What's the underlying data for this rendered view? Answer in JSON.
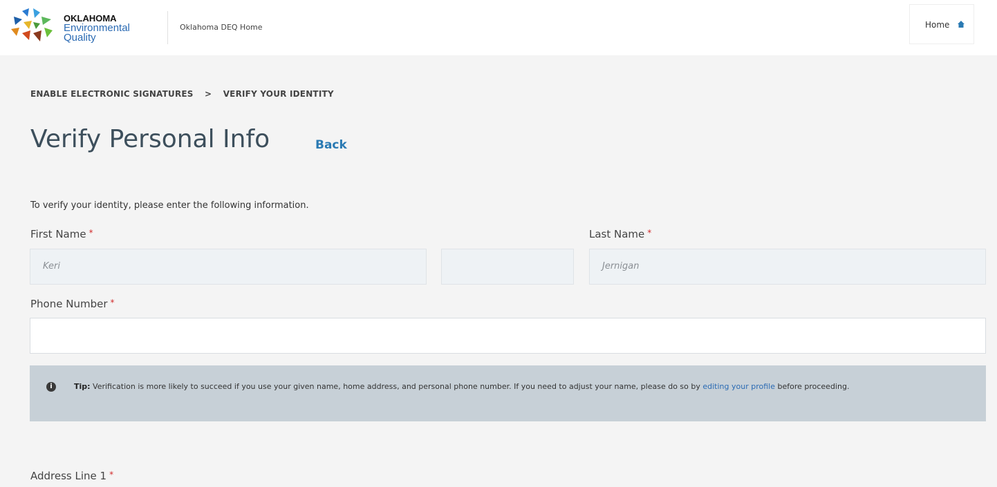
{
  "header": {
    "logo_line1": "OKLAHOMA",
    "logo_line2": "Environmental",
    "logo_line3": "Quality",
    "site_link": "Oklahoma DEQ Home",
    "home_label": "Home"
  },
  "breadcrumb": {
    "item1": "ENABLE ELECTRONIC SIGNATURES",
    "separator": ">",
    "item2": "VERIFY YOUR IDENTITY"
  },
  "page": {
    "title": "Verify Personal Info",
    "back_label": "Back",
    "intro": "To verify your identity, please enter the following information."
  },
  "form": {
    "first_name_label": "First Name",
    "first_name_value": "Keri",
    "middle_name_value": "",
    "last_name_label": "Last Name",
    "last_name_value": "Jernigan",
    "phone_label": "Phone Number",
    "phone_value": "",
    "address1_label": "Address Line 1",
    "required_marker": "*"
  },
  "tip": {
    "prefix": "Tip:",
    "text": " Verification is more likely to succeed if you use your given name, home address, and personal phone number. If you need to adjust your name, please do so by ",
    "link": "editing your profile",
    "suffix": " before proceeding."
  },
  "colors": {
    "brand_blue": "#2a6ab3",
    "required_red": "#d12b2b",
    "tip_background": "#c7d0d7"
  }
}
